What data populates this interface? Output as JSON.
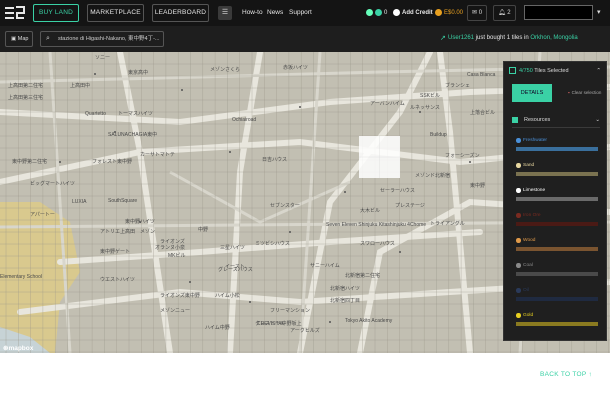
{
  "header": {
    "logo_icon": "earth2-logo",
    "buy_land": "BUY LAND",
    "marketplace": "MARKETPLACE",
    "leaderboard": "LEADERBOARD",
    "menu_icon": "menu-icon",
    "nav": [
      "How-to",
      "News",
      "Support"
    ],
    "essence_count": "0",
    "add_credit": "Add Credit",
    "balance": "E$0.00",
    "messages_count": "0",
    "notifications_count": "2"
  },
  "subbar": {
    "map_label": "Map",
    "search_value": "stazione di Higashi-Nakano, 東中野4丁-...",
    "ticker_user": "User1261",
    "ticker_text": " just bought 1 tiles in ",
    "ticker_place": "Orkhon, Mongolia"
  },
  "map": {
    "labels": [
      "ソニー",
      "メゾンさくら",
      "赤坂ハイツ",
      "東京高中",
      "上高田第二住宅",
      "上高田中",
      "上高田第三住宅",
      "Quartetto",
      "トーマスハイツ",
      "SALUNACHAGIA東中",
      "Ochiairoad",
      "カーサトマトテ",
      "東中野第二住宅",
      "フォレスト東中野",
      "ビッグマートハイツ",
      "LUXIA",
      "SouthSquare",
      "アパートー",
      "東中野ハイツ",
      "アトリエ上高田",
      "メゾン",
      "ライオンズ",
      "MKビル",
      "中野",
      "三星ハイツ",
      "オランヌ小泉",
      "東中野ゲート",
      "イースト",
      "ウエストハイツ",
      "ミツビシハウス",
      "Seven Eleven Shinjuku Kitashinjuku 4Chome",
      "ハイム小松",
      "スワローハウス",
      "グレースハウス",
      "Tokyo Akito Academy",
      "フリーマンション",
      "北新宿ハイツ",
      "北新宿第二住宅",
      "北新宿四丁目",
      "Casa Blanca",
      "ブランシェ",
      "アーバンハイム",
      "ルネッサンス",
      "メゾンド北新宿",
      "東中野",
      "Elementary School",
      "プレステージ",
      "セーラーハウス",
      "クレストール",
      "Buildup",
      "SSKビル",
      "上落合ビル",
      "フォーシーズン",
      "トライアングル",
      "大木ビル",
      "サニーハイム",
      "CREVISTA中野坂上",
      "ハイム中野",
      "ライオンズ東中野",
      "アークヒルズ",
      "メゾンニュー",
      "セブンスター",
      "日吉ハウス"
    ]
  },
  "panel": {
    "tiles_count": "4/750",
    "tiles_label": " Tiles Selected",
    "details_tab": "DETAILS",
    "clear_selection": "Clear selection",
    "resources_title": "Resources",
    "resources": [
      {
        "name": "Freshwater",
        "color": "#4a90d9",
        "bar": "#3a6f9c"
      },
      {
        "name": "Sand",
        "color": "#e8d7a0",
        "bar": "#7a7250"
      },
      {
        "name": "Limestone",
        "color": "#ffffff",
        "bar": "#6a6a6a"
      },
      {
        "name": "Iron Ore",
        "color": "#7a2a20",
        "bar": "#4a1a15"
      },
      {
        "name": "Wood",
        "color": "#e09a4a",
        "bar": "#7a5430"
      },
      {
        "name": "Coal",
        "color": "#8a8a8a",
        "bar": "#4a4a4a"
      },
      {
        "name": "Oil",
        "color": "#2a3a5a",
        "bar": "#1f2a40"
      },
      {
        "name": "Gold",
        "color": "#e8d020",
        "bar": "#8a7a20"
      }
    ]
  },
  "footer": {
    "back_to_top": "BACK TO TOP"
  },
  "colors": {
    "accent": "#3ad1a5",
    "topbar": "#141414",
    "map": "#c2bfb2"
  }
}
